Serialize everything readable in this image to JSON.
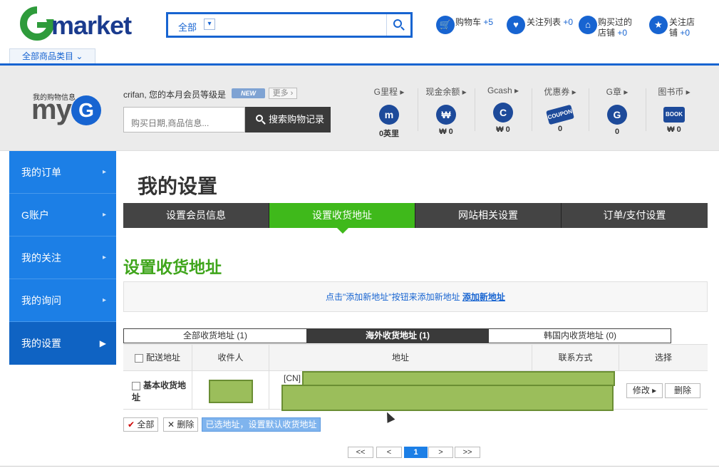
{
  "header": {
    "logo_text": "market",
    "search": {
      "category": "全部",
      "placeholder": ""
    },
    "links": [
      {
        "label": "购物车",
        "count": "+5"
      },
      {
        "label": "关注列表",
        "count": "+0"
      },
      {
        "label_line1": "购买过的",
        "label_line2": "店铺",
        "count": "+0"
      },
      {
        "label_line1": "关注店",
        "label_line2": "铺",
        "count": "+0"
      }
    ],
    "category_menu": "全部商品类目"
  },
  "myg": {
    "logo_caption": "我的购物信息",
    "logo_text": "my",
    "logo_g": "G",
    "greeting": "crifan, 您的本月会员等级是",
    "badge": "NEW",
    "more": "更多",
    "search_placeholder": "购买日期,商品信息...",
    "search_button": "搜索购物记录",
    "stats": [
      {
        "label": "G里程",
        "icon": "m",
        "value": "0英里"
      },
      {
        "label": "现金余额",
        "icon": "₩",
        "value": "₩ 0"
      },
      {
        "label": "Gcash",
        "icon": "C",
        "value": "₩ 0"
      },
      {
        "label": "优惠券",
        "icon": "COUPON",
        "value": "0"
      },
      {
        "label": "G章",
        "icon": "G",
        "value": "0"
      },
      {
        "label": "图书币",
        "icon": "BOOK",
        "value": "₩ 0"
      }
    ]
  },
  "sidebar": {
    "items": [
      {
        "label": "我的订单"
      },
      {
        "label": "G账户"
      },
      {
        "label": "我的关注"
      },
      {
        "label": "我的询问"
      },
      {
        "label": "我的设置"
      }
    ]
  },
  "main": {
    "page_title": "我的设置",
    "tabs": [
      "设置会员信息",
      "设置收货地址",
      "网站相关设置",
      "订单/支付设置"
    ],
    "section_title": "设置收货地址",
    "notice_text": "点击\"添加新地址\"按钮来添加新地址",
    "notice_link": "添加新地址",
    "subtabs": [
      "全部收货地址 (1)",
      "海外收货地址 (1)",
      "韩国内收货地址 (0)"
    ],
    "table": {
      "headers": [
        "配送地址",
        "收件人",
        "地址",
        "联系方式",
        "选择"
      ],
      "row": {
        "type": "基本收货地址",
        "address_prefix": "[CN]",
        "edit": "修改",
        "delete": "删除"
      }
    },
    "actions": {
      "all": "全部",
      "delete": "删除",
      "set_default": "已选地址，设置默认收货地址"
    },
    "pagination": [
      "<<",
      "<",
      "1",
      ">",
      ">>"
    ]
  }
}
